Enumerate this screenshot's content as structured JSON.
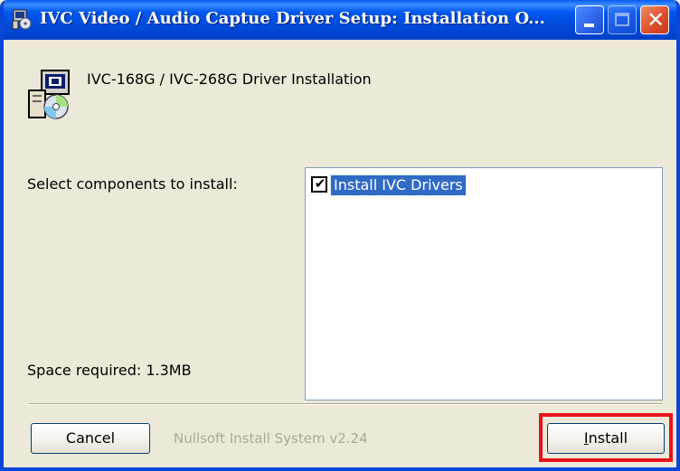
{
  "window": {
    "title": "IVC Video / Audio Captue Driver Setup: Installation O..."
  },
  "header": {
    "text": "IVC-168G / IVC-268G Driver Installation",
    "icon": "installer-disc-icon"
  },
  "components": {
    "label": "Select components to install:",
    "items": [
      {
        "label": "Install IVC Drivers",
        "checked": true,
        "selected": true
      }
    ]
  },
  "space_required": "Space required: 1.3MB",
  "footer": {
    "cancel_label": "Cancel",
    "brand": "Nullsoft Install System v2.24",
    "install_label": "Install"
  },
  "colors": {
    "titlebar": "#0058ee",
    "selection": "#316ac5",
    "highlight": "#e8131a",
    "background": "#ece9d8"
  }
}
